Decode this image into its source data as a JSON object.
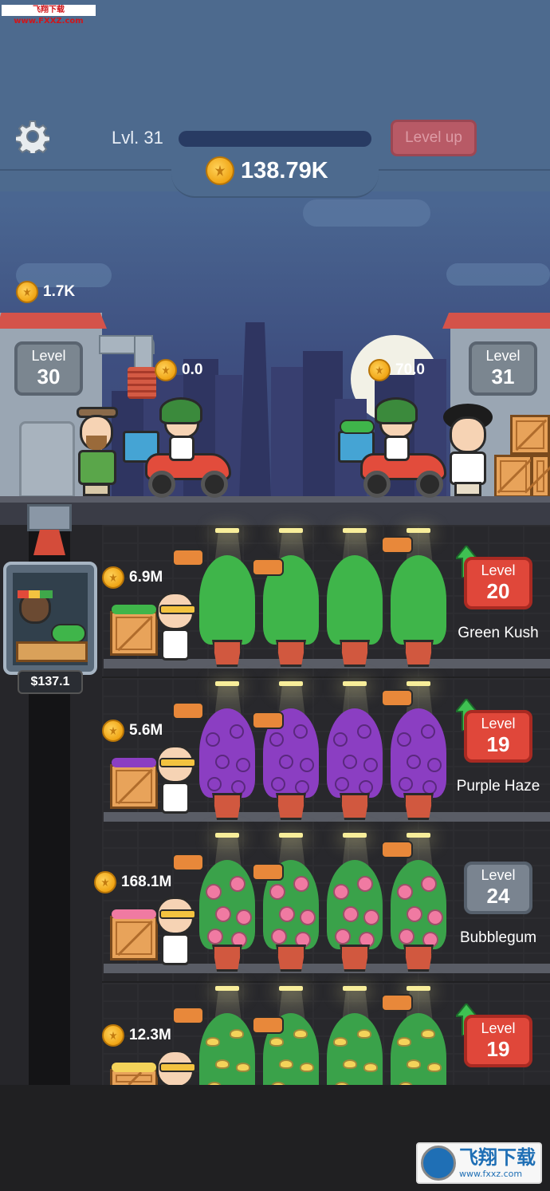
{
  "watermark_top": "飞翔下载 www.FXXZ.com",
  "header": {
    "level_label": "Lvl. 31",
    "xp_progress": 0.0,
    "level_up_label": "Level up",
    "total_coins": "138.79K"
  },
  "warehouse": {
    "stored": "1.7K",
    "level_title": "Level",
    "level": "30",
    "courier_coins": "0.0"
  },
  "market": {
    "level_title": "Level",
    "level": "31",
    "courier_coins": "70.0"
  },
  "elevator": {
    "money": "$137.1"
  },
  "floors": [
    {
      "earnings": "6.9M",
      "level_title": "Level",
      "level": "20",
      "strain": "Green Kush",
      "upgrade_available": true,
      "color": "#3fb54a"
    },
    {
      "earnings": "5.6M",
      "level_title": "Level",
      "level": "19",
      "strain": "Purple Haze",
      "upgrade_available": true,
      "color": "#8b3ec2"
    },
    {
      "earnings": "168.1M",
      "level_title": "Level",
      "level": "24",
      "strain": "Bubblegum",
      "upgrade_available": false,
      "color": "#f07aa2"
    },
    {
      "earnings": "12.3M",
      "level_title": "Level",
      "level": "19",
      "strain": "",
      "upgrade_available": true,
      "color": "#f4d35a"
    }
  ],
  "watermark_logo": {
    "title": "飞翔下载",
    "url": "www.fxxz.com"
  },
  "colors": {
    "sky": "#4d6a8e",
    "accent_red": "#e0473a",
    "coin": "#f0a515"
  }
}
